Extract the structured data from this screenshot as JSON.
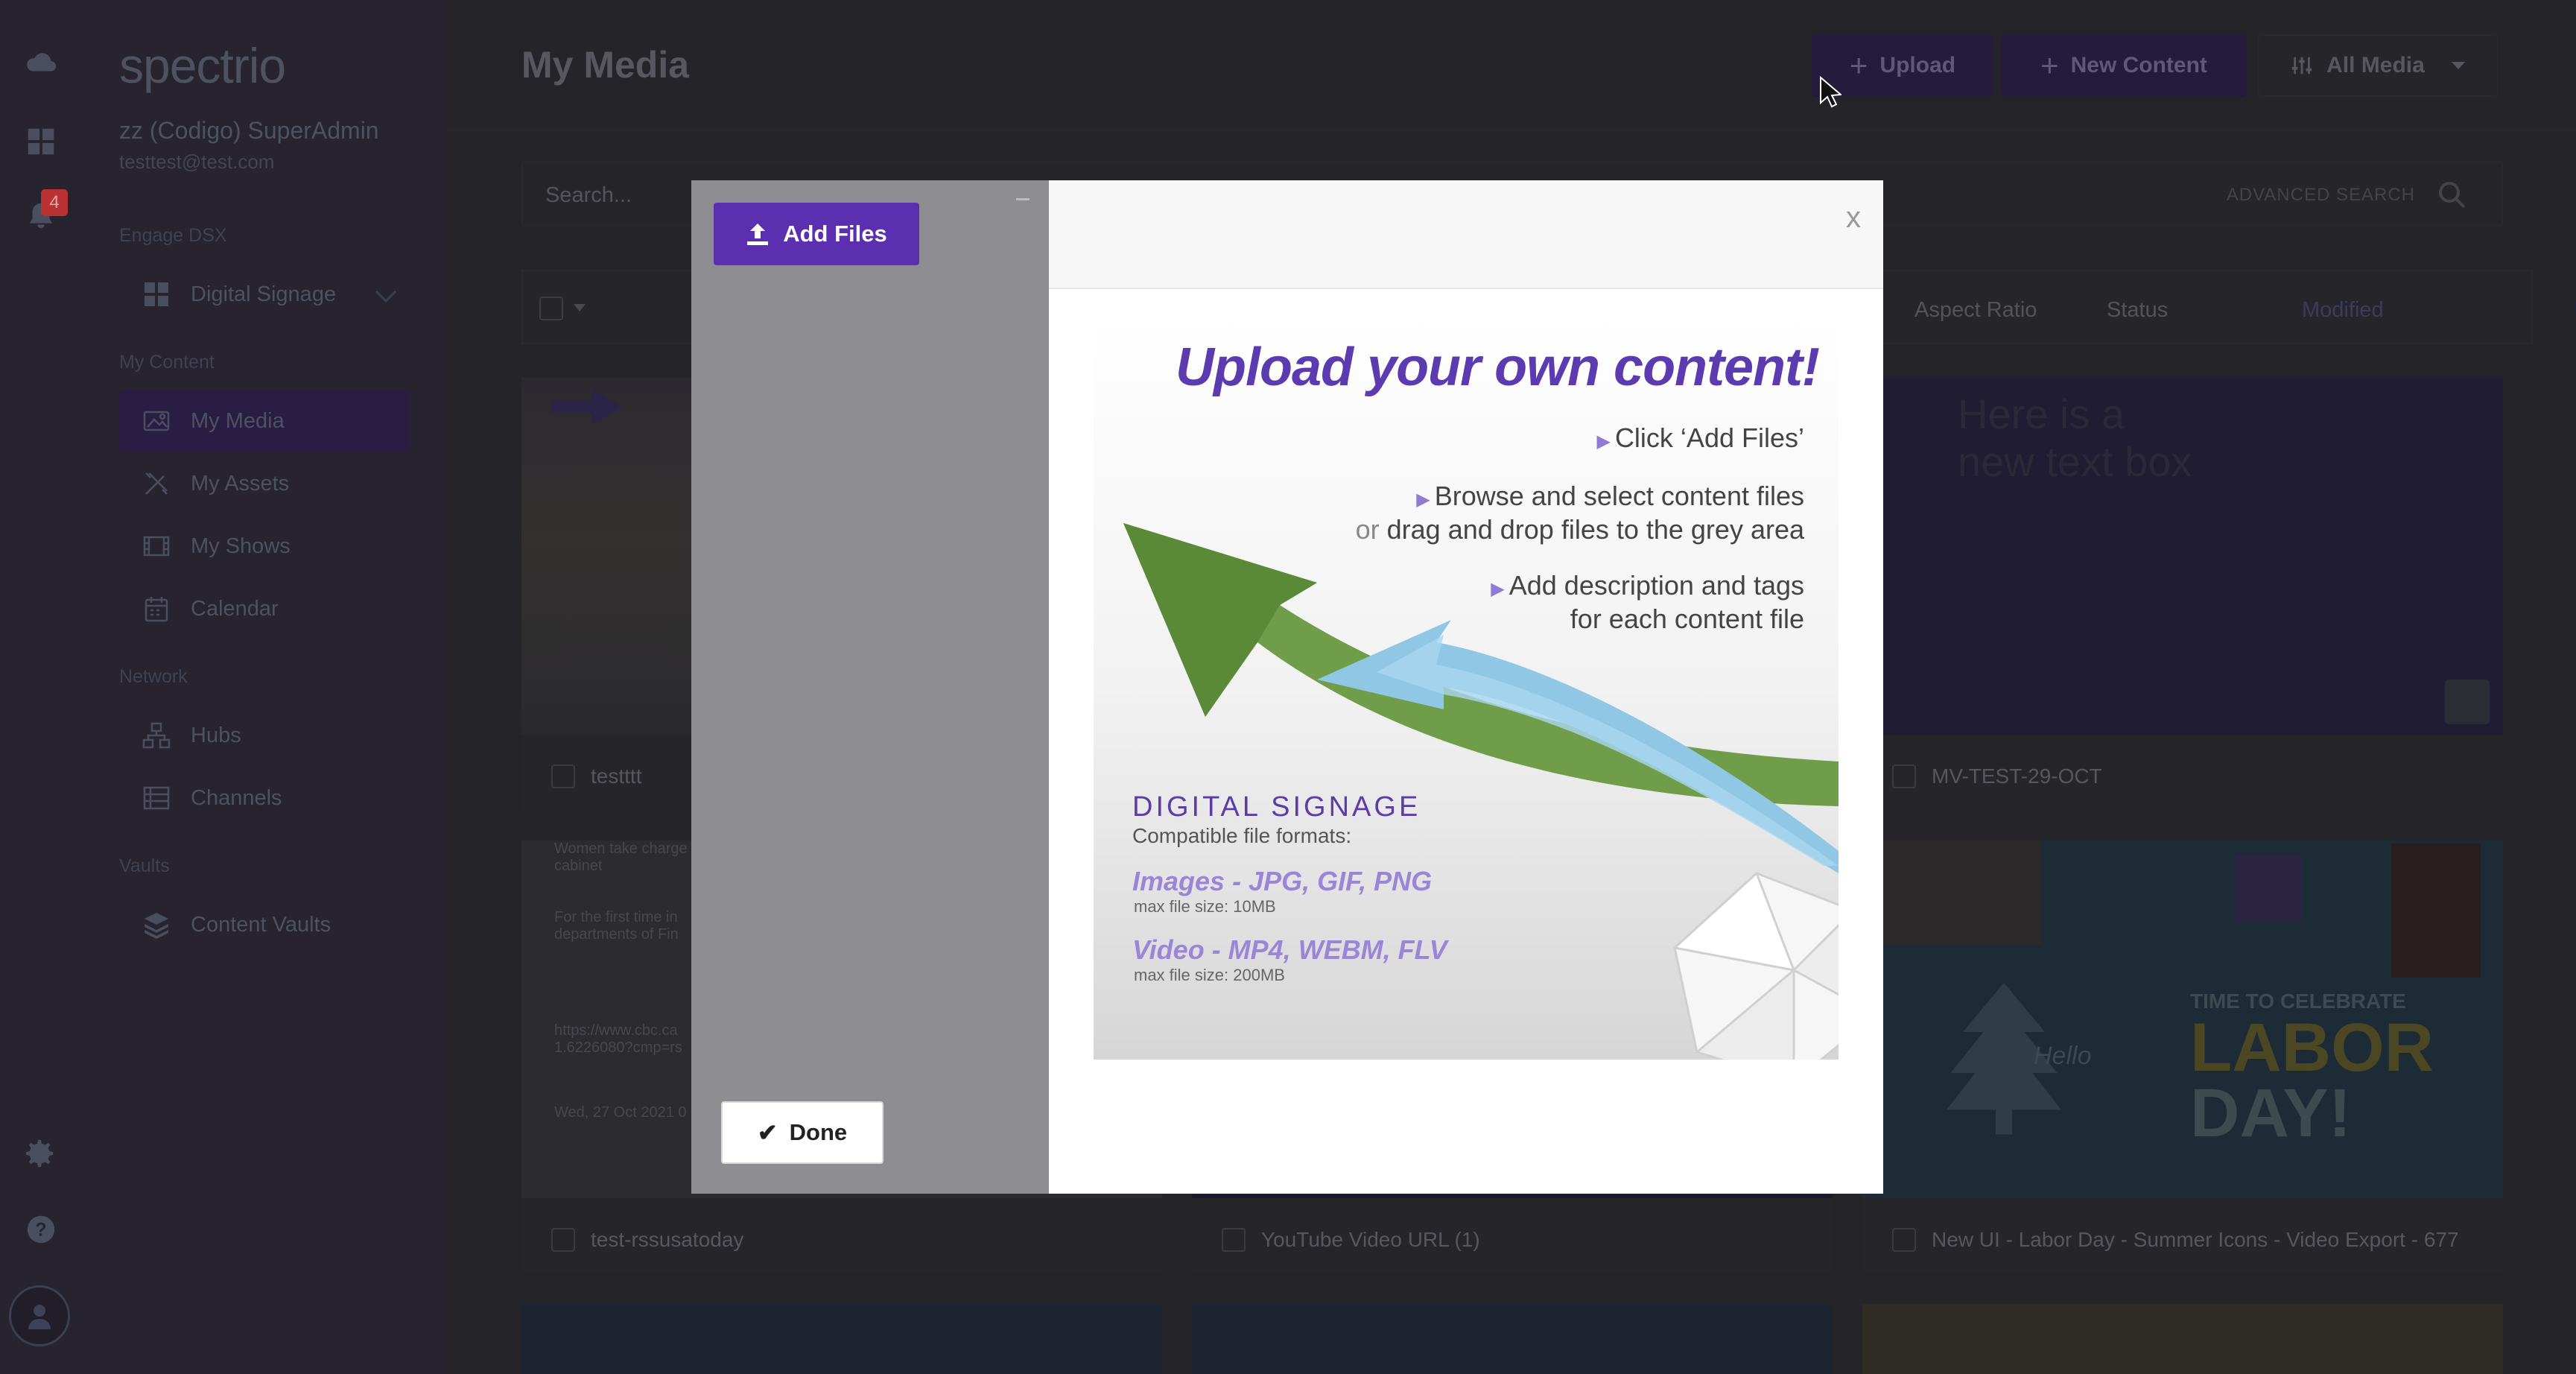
{
  "app": {
    "logo": "spectrio",
    "user_name": "zz (Codigo) SuperAdmin",
    "user_email": "testtest@test.com",
    "notification_count": "4"
  },
  "sidebar": {
    "section_engage": "Engage DSX",
    "digital_signage": "Digital Signage",
    "section_content": "My Content",
    "my_media": "My Media",
    "my_assets": "My Assets",
    "my_shows": "My Shows",
    "calendar": "Calendar",
    "section_network": "Network",
    "hubs": "Hubs",
    "channels": "Channels",
    "section_vaults": "Vaults",
    "content_vaults": "Content Vaults"
  },
  "header": {
    "title": "My Media",
    "upload": "Upload",
    "new_content": "New Content",
    "all_media": "All Media"
  },
  "search": {
    "placeholder": "Search...",
    "advanced": "ADVANCED SEARCH"
  },
  "columns": {
    "aspect_ratio": "Aspect Ratio",
    "status": "Status",
    "modified": "Modified"
  },
  "cards": [
    {
      "label": "testttt"
    },
    {
      "label": "MV-TEST-29-OCT"
    },
    {
      "label": "test-rssusatoday"
    },
    {
      "label": "YouTube Video URL (1)"
    },
    {
      "label": "New UI - Labor Day - Summer Icons - Video Export - 677"
    }
  ],
  "card_text": {
    "textbox": "Here is a new text box",
    "rss_1": "Women take charge cabinet",
    "rss_2": "For the first time in departments of Fin",
    "rss_3": "https://www.cbc.ca 1.6226080?cmp=rs",
    "rss_4": "Wed, 27 Oct 2021 0",
    "labor_1": "TIME TO CELEBRATE",
    "labor_2": "LABOR",
    "labor_3": "DAY!",
    "labor_hello": "Hello"
  },
  "modal": {
    "add_files": "Add Files",
    "done": "Done",
    "close": "x",
    "promo": {
      "title": "Upload your own content!",
      "step1": "Click ‘Add Files’",
      "step2a": "Browse and select content files",
      "step2_or": "or",
      "step2b": "drag and drop files to the grey area",
      "step3a": "Add description and tags",
      "step3b": "for each content file",
      "ds_title": "DIGITAL SIGNAGE",
      "ds_sub": "Compatible file formats:",
      "images": "Images - JPG, GIF, PNG",
      "images_size": "max file size: 10MB",
      "video": "Video - MP4, WEBM, FLV",
      "video_size": "max file size: 200MB"
    }
  }
}
